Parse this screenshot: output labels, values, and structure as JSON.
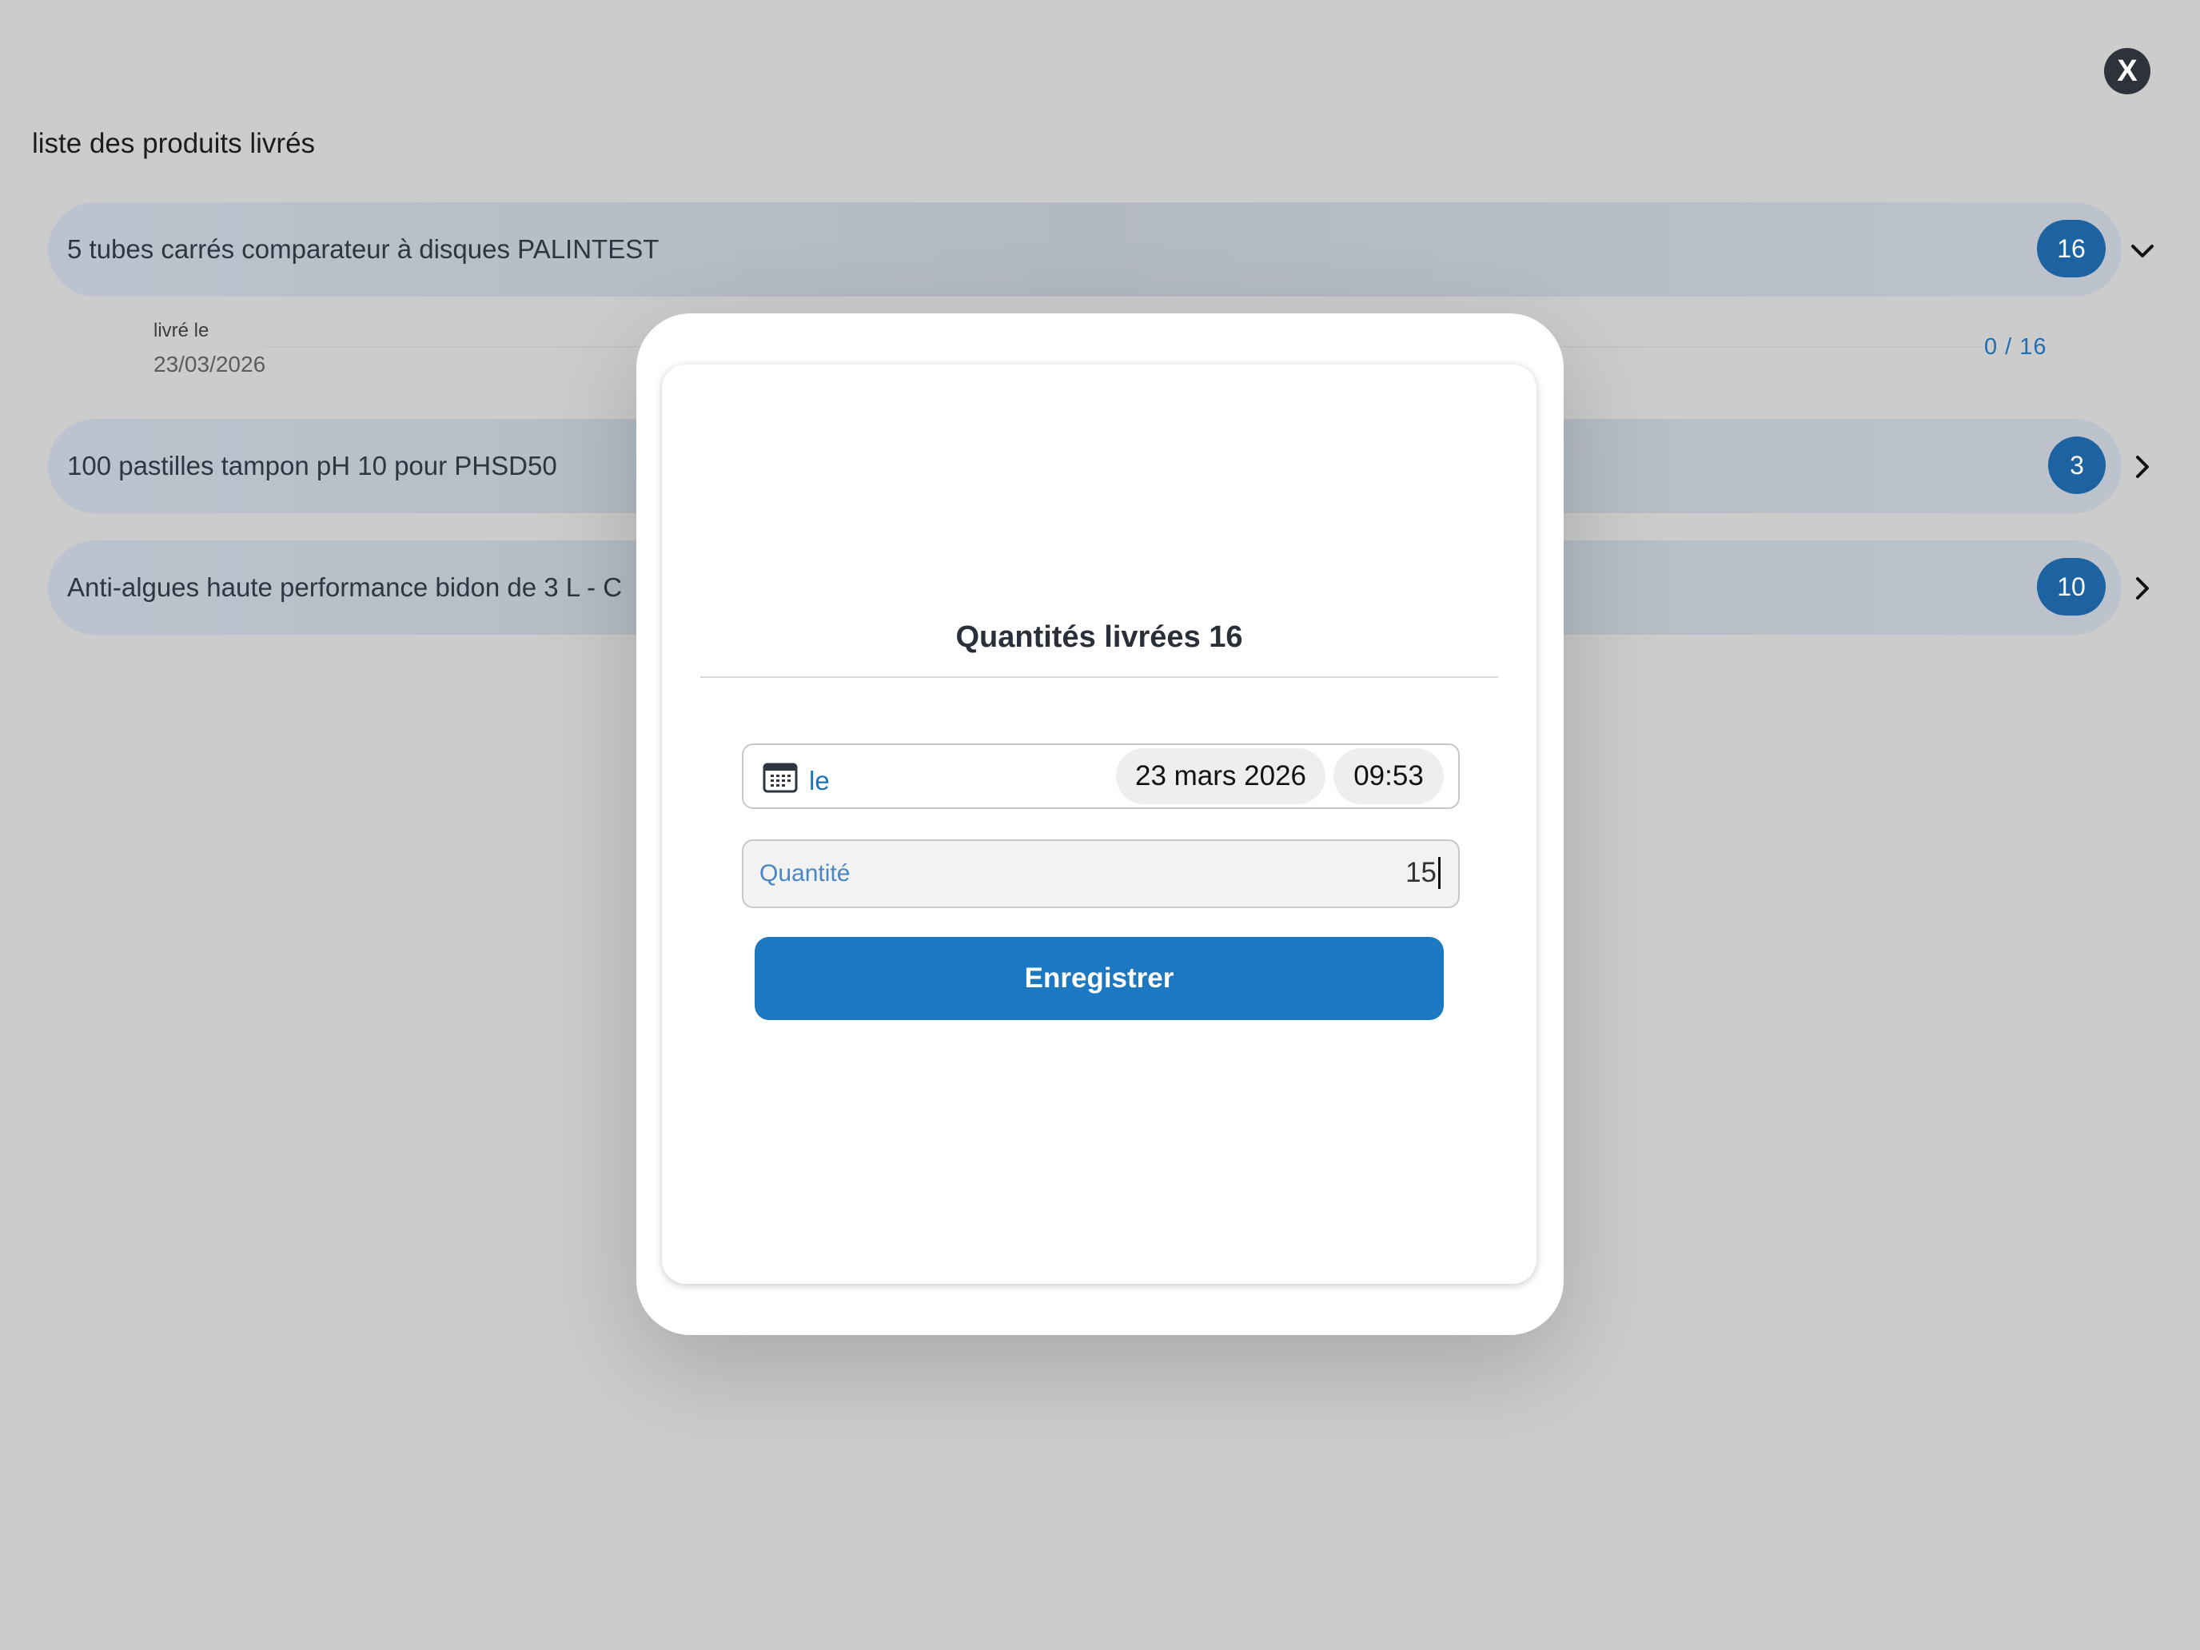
{
  "close_button": {
    "label": "X"
  },
  "list": {
    "title": "liste des produits livrés",
    "products": [
      {
        "name": "5 tubes carrés comparateur à disques PALINTEST",
        "count": "16",
        "expanded": true
      },
      {
        "name": "100 pastilles tampon pH 10 pour PHSD50",
        "count": "3",
        "expanded": false
      },
      {
        "name": "Anti-algues haute performance bidon de 3 L - C",
        "count": "10",
        "expanded": false
      }
    ],
    "delivery": {
      "label": "livré le",
      "date": "23/03/2026",
      "progress": "0 / 16"
    }
  },
  "modal": {
    "title": "Quantités livrées 16",
    "date_field": {
      "icon": "calendar-icon",
      "label": "le",
      "date": "23 mars 2026",
      "time": "09:53"
    },
    "quantity_field": {
      "label": "Quantité",
      "value": "15"
    },
    "save_button": "Enregistrer"
  },
  "colors": {
    "accent": "#1b78c1",
    "badge": "#1d62a1",
    "overlay_background": "#cccccc"
  }
}
